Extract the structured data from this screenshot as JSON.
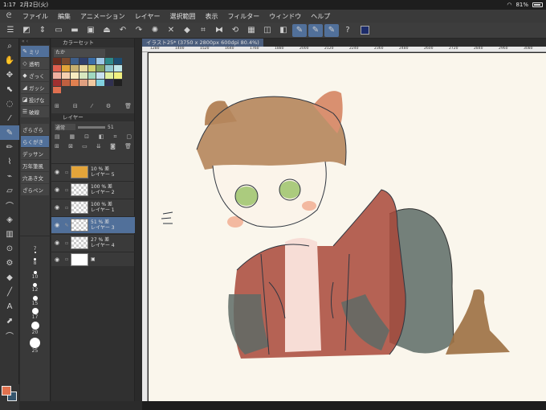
{
  "status": {
    "time": "1:17",
    "date": "2月2日(火)",
    "battery": "81%"
  },
  "menu": [
    "ファイル",
    "編集",
    "アニメーション",
    "レイヤー",
    "選択範囲",
    "表示",
    "フィルター",
    "ウィンドウ",
    "ヘルプ"
  ],
  "toolbar_icons": [
    "menu-icon",
    "transform-icon",
    "save-icon",
    "folder-icon",
    "undo-icon",
    "redo-icon",
    "brush-settings-icon",
    "select-icon",
    "fill-icon",
    "crop-icon",
    "flip-icon",
    "rotate-icon",
    "snap-icon",
    "pen-icon-1",
    "pen-icon-2",
    "pen-icon-3",
    "help-icon",
    "color-icon"
  ],
  "subtools": [
    {
      "label": "ミリ",
      "icon": "pen-icon",
      "selected": true
    },
    {
      "label": "透明",
      "icon": "eraser-icon",
      "selected": false
    },
    {
      "label": "ざっく",
      "icon": "eraser-icon",
      "selected": false
    },
    {
      "label": "ガッシ",
      "icon": "pencil-icon",
      "selected": false
    },
    {
      "label": "投げな",
      "icon": "fill-icon",
      "selected": false
    },
    {
      "label": "破線",
      "icon": "line-icon",
      "selected": false
    }
  ],
  "brushes": [
    {
      "label": "ざらざら",
      "selected": false
    },
    {
      "label": "らくがき",
      "selected": true
    },
    {
      "label": "デッサン",
      "selected": false
    },
    {
      "label": "万年筆風",
      "selected": false
    },
    {
      "label": "穴あき文",
      "selected": false
    },
    {
      "label": "ざらペン",
      "selected": false
    }
  ],
  "sizes": [
    "7",
    "8",
    "10",
    "12",
    "15",
    "17",
    "20",
    "25"
  ],
  "color_panel": {
    "title": "カラーセット",
    "set_name": "たか",
    "swatches": [
      "#6a2c1e",
      "#7a4a2e",
      "#3f5f8a",
      "#2f3f6a",
      "#3a6ea8",
      "#9ec8e6",
      "#2c8a8a",
      "#1d4e72",
      "#e06050",
      "#e3a43a",
      "#c8b070",
      "#e8d9a0",
      "#d0d070",
      "#80a060",
      "#90c8d0",
      "#bfe6e8",
      "#f0b0a0",
      "#f5d0b0",
      "#f7ecc0",
      "#d8e8c0",
      "#a0d8c0",
      "#c8e0f0",
      "#e0f0a0",
      "#f0f080",
      "#a03030",
      "#c06040",
      "#e08050",
      "#e0a080",
      "#f0c8a0",
      "#80d0e0",
      "#303050",
      "#202020",
      "#e07050",
      "",
      "",
      "",
      "",
      "",
      "",
      ""
    ]
  },
  "layer_panel": {
    "title": "レイヤー",
    "blend_mode": "通常",
    "opacity": "51",
    "layers": [
      {
        "opacity": "10 %",
        "mode": "差",
        "name": "レイヤー 5",
        "thumb": "fill",
        "selected": false
      },
      {
        "opacity": "100 %",
        "mode": "差",
        "name": "レイヤー 2",
        "thumb": "check",
        "selected": false
      },
      {
        "opacity": "100 %",
        "mode": "差",
        "name": "レイヤー 1",
        "thumb": "check",
        "selected": false
      },
      {
        "opacity": "51 %",
        "mode": "差",
        "name": "レイヤー 3",
        "thumb": "check",
        "selected": true
      },
      {
        "opacity": "27 %",
        "mode": "差",
        "name": "レイヤー 4",
        "thumb": "check",
        "selected": false
      },
      {
        "opacity": "",
        "mode": "",
        "name": "",
        "thumb": "white",
        "selected": false
      }
    ]
  },
  "document": {
    "tab": "イラスト25* (3750 x 2800px 600dpi 80.4%)"
  },
  "ruler_ticks": [
    "1280",
    "1400",
    "1520",
    "1640",
    "1760",
    "1880",
    "2000",
    "2120",
    "2240",
    "2360",
    "2480",
    "2600",
    "2720",
    "2840",
    "2960",
    "3080"
  ],
  "colors": {
    "foreground": "#e0714e",
    "background": "#36556d",
    "accent": "#51709a"
  }
}
